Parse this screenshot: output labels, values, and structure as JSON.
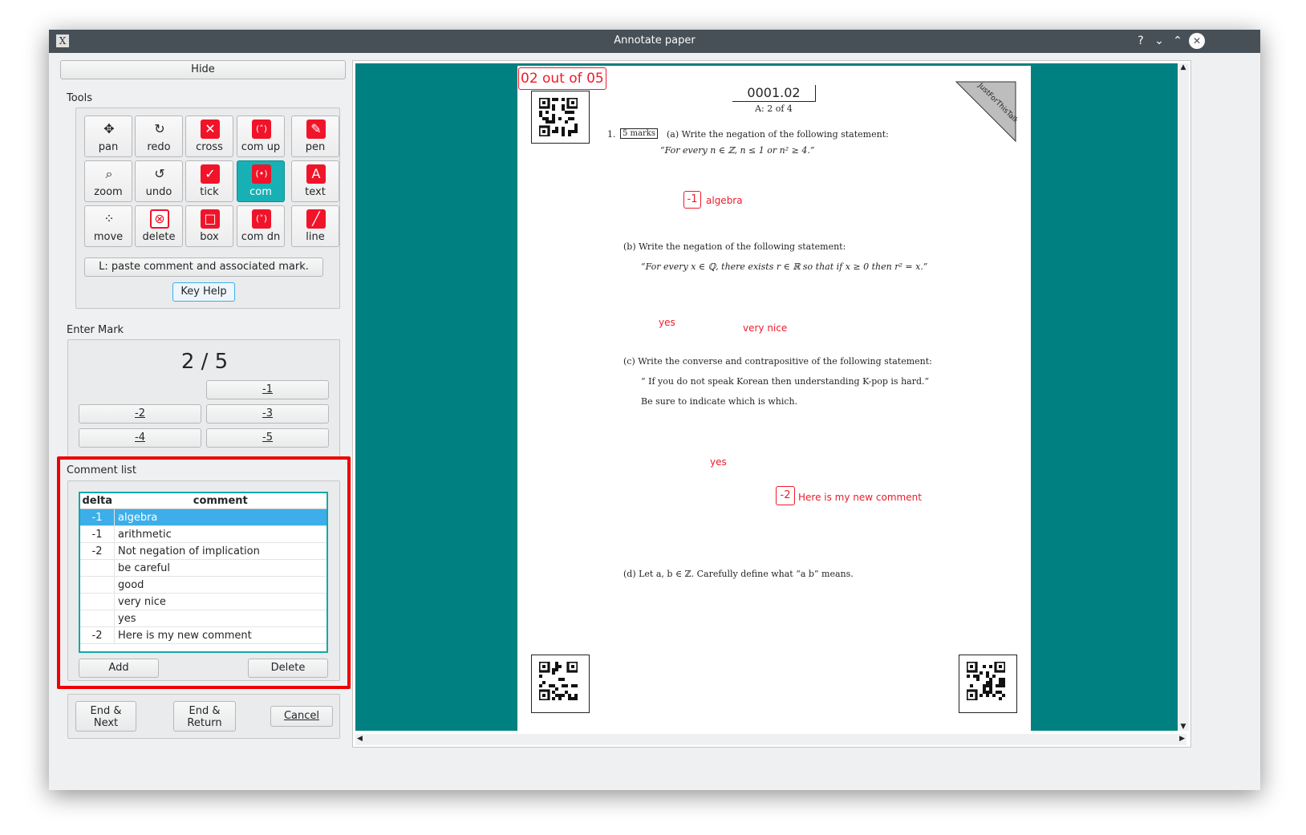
{
  "window": {
    "title": "Annotate paper",
    "title_buttons": [
      "?",
      "⌄",
      "⌃",
      "✕"
    ]
  },
  "left": {
    "hide_label": "Hide",
    "tools_label": "Tools",
    "tools": [
      {
        "label": "pan",
        "icon": "pan-icon",
        "glyph": "✥"
      },
      {
        "label": "redo",
        "icon": "redo-icon",
        "glyph": "↻"
      },
      {
        "label": "cross",
        "icon": "cross-icon",
        "glyph": "✕"
      },
      {
        "label": "com up",
        "icon": "comment-up-icon",
        "glyph": "(˄)"
      },
      {
        "label": "pen",
        "icon": "pen-icon",
        "glyph": "✎"
      },
      {
        "label": "zoom",
        "icon": "zoom-icon",
        "glyph": "⌕"
      },
      {
        "label": "undo",
        "icon": "undo-icon",
        "glyph": "↺"
      },
      {
        "label": "tick",
        "icon": "tick-icon",
        "glyph": "✓"
      },
      {
        "label": "com",
        "icon": "comment-icon",
        "glyph": "(•)"
      },
      {
        "label": "text",
        "icon": "text-icon",
        "glyph": "A"
      },
      {
        "label": "move",
        "icon": "move-icon",
        "glyph": "⁘"
      },
      {
        "label": "delete",
        "icon": "delete-icon",
        "glyph": "⊗"
      },
      {
        "label": "box",
        "icon": "box-icon",
        "glyph": "□"
      },
      {
        "label": "com dn",
        "icon": "comment-down-icon",
        "glyph": "(˅)"
      },
      {
        "label": "line",
        "icon": "line-icon",
        "glyph": "╱"
      }
    ],
    "active_tool": "com",
    "hint": "L: paste comment and associated mark.",
    "key_help": "Key Help",
    "enter_mark_label": "Enter Mark",
    "score": "2 / 5",
    "mark_buttons": [
      "-1",
      "-2",
      "-3",
      "-4",
      "-5"
    ],
    "comment_list_label": "Comment list",
    "comment_columns": [
      "delta",
      "comment"
    ],
    "comments": [
      {
        "delta": "-1",
        "comment": "algebra"
      },
      {
        "delta": "-1",
        "comment": "arithmetic"
      },
      {
        "delta": "-2",
        "comment": "Not negation of implication"
      },
      {
        "delta": "",
        "comment": "be careful"
      },
      {
        "delta": "",
        "comment": "good"
      },
      {
        "delta": "",
        "comment": "very nice"
      },
      {
        "delta": "",
        "comment": "yes"
      },
      {
        "delta": "-2",
        "comment": "Here is my new comment"
      }
    ],
    "add_label": "Add",
    "delete_label": "Delete",
    "end_next": "End & Next",
    "end_return": "End & Return",
    "cancel": "Cancel",
    "highlight_color": "#ee0000"
  },
  "paper": {
    "page_stamp": "02 out of 05",
    "test_id": "0001.02",
    "subtitle": "A: 2 of 4",
    "corner_stamp": "JustForThisTalk",
    "q_number": "1.",
    "marks_box": "5 marks",
    "qa": "(a)  Write the negation of the following statement:",
    "qa_stmt": "“For every n ∈ ℤ, n ≤ 1 or n² ≥ 4.”",
    "qb": "(b)  Write the negation of the following statement:",
    "qb_stmt": "“For every x ∈ ℚ, there exists r ∈ ℝ so that if x ≥ 0 then r² = x.”",
    "qc": "(c)  Write the converse and contrapositive of the following statement:",
    "qc_stmt": "“ If you do not speak Korean then understanding K-pop is hard.”",
    "qc_note": "Be sure to indicate which is which.",
    "qd": "(d)  Let a, b ∈ ℤ. Carefully define what “a   b” means.",
    "annotations": {
      "a1_delta": "-1",
      "a1_text": "algebra",
      "b1": "yes",
      "b2": "very nice",
      "c1": "yes",
      "c2_delta": "-2",
      "c2_text": "Here is my new comment"
    },
    "bg_color": "#008080",
    "annot_color": "#ef1a2b"
  }
}
